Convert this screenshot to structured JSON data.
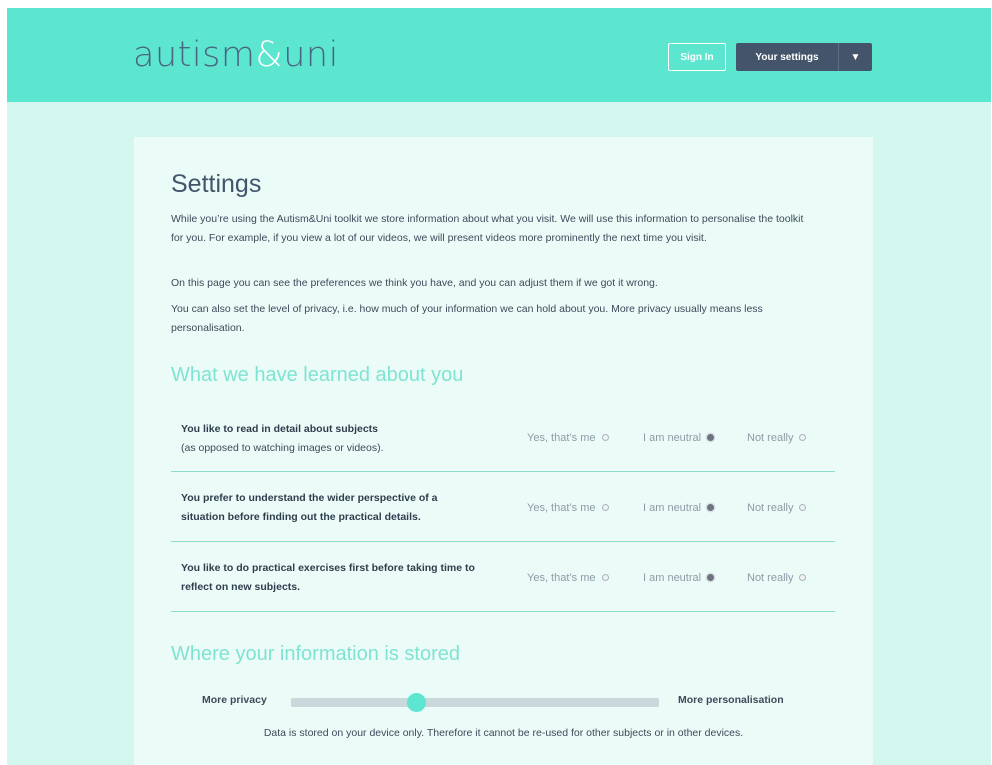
{
  "header": {
    "logo_left": "autism",
    "logo_amp": "&",
    "logo_right": "uni",
    "signin_label": "Sign In",
    "settings_label": "Your settings",
    "settings_caret": "▼"
  },
  "page": {
    "title": "Settings",
    "paragraphs": [
      "While you’re using the Autism&Uni toolkit we store information about what you visit. We will use this information to personalise the toolkit for you. For example, if you view a lot of our videos, we will present videos more prominently the next time you visit.",
      "On this page you can see the preferences we think you have, and you can adjust them if we got it wrong.",
      "You can also set the level of privacy, i.e. how much of your information we can hold about you. More privacy usually means less personalisation."
    ]
  },
  "learned": {
    "heading": "What we have learned about you",
    "options": [
      "Yes, that’s me",
      "I am neutral",
      "Not really"
    ],
    "rows": [
      {
        "question": "You like to read in detail about subjects",
        "sub": "(as opposed to watching images or videos).",
        "selected": "I am neutral"
      },
      {
        "question": "You prefer to understand the wider perspective of a situation before finding out the practical details.",
        "sub": "",
        "selected": "I am neutral"
      },
      {
        "question": "You like to do practical exercises first before taking time to reflect on new subjects.",
        "sub": "",
        "selected": "I am neutral"
      }
    ]
  },
  "storage": {
    "heading": "Where your information is stored",
    "left_label": "More privacy",
    "right_label": "More personalisation",
    "slider_position_fraction": 0.34,
    "note": "Data is stored on your device only. Therefore it cannot be re-used for other subjects or in other devices."
  },
  "colors": {
    "header": "#5ce6cf",
    "accent_heading": "#7fe3d1",
    "dark_button": "#44546b",
    "background": "#d3f6ee"
  }
}
